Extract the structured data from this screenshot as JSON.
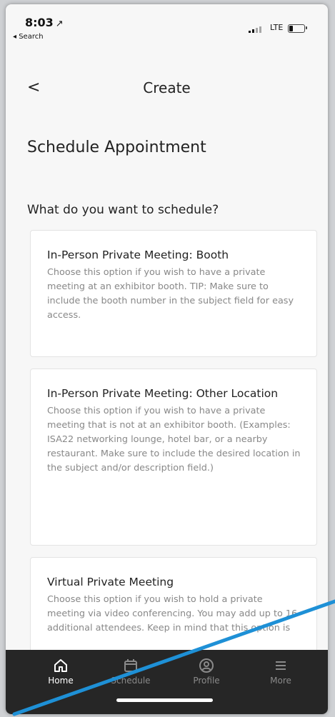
{
  "status_bar": {
    "time": "8:03",
    "location_arrow": "↗",
    "back_app": "◂ Search",
    "network": "LTE"
  },
  "header": {
    "back_symbol": "<",
    "title": "Create"
  },
  "page_title": "Schedule Appointment",
  "question": "What do you want to schedule?",
  "options": [
    {
      "title": "In-Person Private Meeting: Booth",
      "description": "Choose this option if you wish to have a private meeting at an exhibitor booth. TIP: Make sure to include the booth number in the subject field for easy access."
    },
    {
      "title": "In-Person Private Meeting: Other Location",
      "description": "Choose this option if you wish to have a private meeting that is not at an exhibitor booth. (Examples: ISA22 networking lounge, hotel bar, or a nearby restaurant. Make sure to include the desired location in the subject and/or description field.)"
    },
    {
      "title": "Virtual Private Meeting",
      "description": "Choose this option if you wish to hold a private meeting via video conferencing. You may add up to 16 additional attendees. Keep in mind that this option is"
    }
  ],
  "tabbar": {
    "items": [
      {
        "label": "Home",
        "icon": "home-icon",
        "active": true
      },
      {
        "label": "Schedule",
        "icon": "calendar-icon",
        "active": false
      },
      {
        "label": "Profile",
        "icon": "profile-icon",
        "active": false
      },
      {
        "label": "More",
        "icon": "menu-icon",
        "active": false
      }
    ]
  },
  "colors": {
    "background": "#f7f7f7",
    "card": "#ffffff",
    "tabbar": "#262626",
    "tab_active": "#ffffff",
    "tab_inactive": "#8a8a8a",
    "description_text": "#888888",
    "annotation_line": "#1e90d6"
  }
}
